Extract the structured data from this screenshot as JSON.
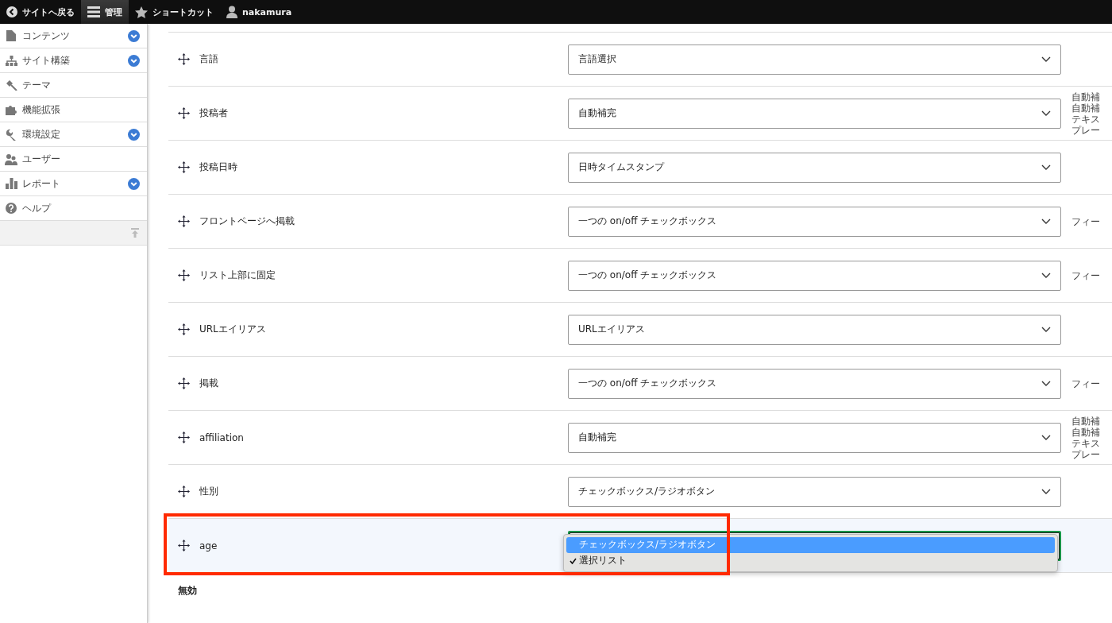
{
  "toolbar": {
    "items": [
      {
        "kind": "back",
        "label": "サイトへ戻る",
        "selected": false
      },
      {
        "kind": "menu",
        "label": "管理",
        "selected": true
      },
      {
        "kind": "star",
        "label": "ショートカット",
        "selected": false
      },
      {
        "kind": "user",
        "label": "nakamura",
        "selected": false
      }
    ]
  },
  "sidebar": {
    "items": [
      {
        "label": "コンテンツ",
        "expandable": true
      },
      {
        "label": "サイト構築",
        "expandable": true
      },
      {
        "label": "テーマ",
        "expandable": false
      },
      {
        "label": "機能拡張",
        "expandable": false
      },
      {
        "label": "環境設定",
        "expandable": true
      },
      {
        "label": "ユーザー",
        "expandable": false
      },
      {
        "label": "レポート",
        "expandable": true
      },
      {
        "label": "ヘルプ",
        "expandable": false
      }
    ]
  },
  "fields": [
    {
      "label": "言語",
      "widget": "言語選択"
    },
    {
      "label": "投稿者",
      "widget": "自動補完",
      "description": [
        "自動補",
        "自動補",
        "テキス",
        "プレー"
      ]
    },
    {
      "label": "投稿日時",
      "widget": "日時タイムスタンプ"
    },
    {
      "label": "フロントページへ掲載",
      "widget": "一つの on/off チェックボックス",
      "description": [
        "フィー"
      ]
    },
    {
      "label": "リスト上部に固定",
      "widget": "一つの on/off チェックボックス",
      "description": [
        "フィー"
      ]
    },
    {
      "label": "URLエイリアス",
      "widget": "URLエイリアス"
    },
    {
      "label": "掲載",
      "widget": "一つの on/off チェックボックス",
      "description": [
        "フィー"
      ]
    },
    {
      "label": "affiliation",
      "widget": "自動補完",
      "description": [
        "自動補",
        "自動補",
        "テキス",
        "プレー"
      ]
    },
    {
      "label": "性別",
      "widget": "チェックボックス/ラジオボタン"
    },
    {
      "label": "age",
      "highlighted": true,
      "open_options": [
        {
          "label": "チェックボックス/ラジオボタン",
          "highlighted": true,
          "checked": false
        },
        {
          "label": "選択リスト",
          "highlighted": false,
          "checked": true
        }
      ]
    }
  ],
  "disabled_heading": "無効"
}
